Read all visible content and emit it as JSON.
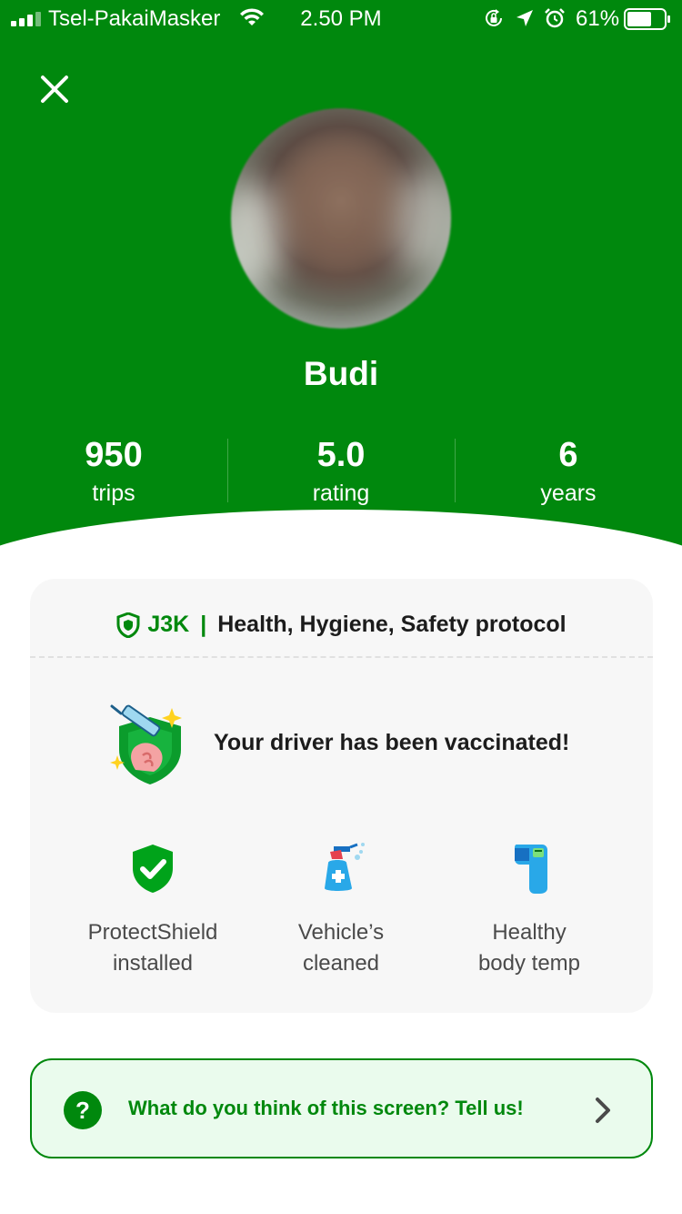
{
  "status_bar": {
    "carrier": "Tsel-PakaiMasker",
    "time": "2.50 PM",
    "battery_percent": "61%",
    "icons": [
      "signal-icon",
      "wifi-icon",
      "orientation-lock-icon",
      "location-arrow-icon",
      "alarm-icon",
      "battery-icon"
    ]
  },
  "header": {
    "close_icon": "close-icon",
    "driver_name": "Budi",
    "stats": [
      {
        "value": "950",
        "label": "trips"
      },
      {
        "value": "5.0",
        "label": "rating"
      },
      {
        "value": "6",
        "label": "years"
      }
    ]
  },
  "safety_card": {
    "badge": "J3K",
    "separator": "|",
    "title": "Health, Hygiene, Safety protocol",
    "vaccination_text": "Your driver has been vaccinated!",
    "features": [
      {
        "icon": "shield-check-icon",
        "line1": "ProtectShield",
        "line2": "installed"
      },
      {
        "icon": "spray-bottle-icon",
        "line1": "Vehicle’s",
        "line2": "cleaned"
      },
      {
        "icon": "thermometer-gun-icon",
        "line1": "Healthy",
        "line2": "body temp"
      }
    ]
  },
  "feedback": {
    "icon": "question-icon",
    "text": "What do you think of this screen? Tell us!"
  },
  "colors": {
    "brand_green": "#00880d",
    "feedback_bg": "#eafbed",
    "card_bg": "#f7f7f7"
  }
}
